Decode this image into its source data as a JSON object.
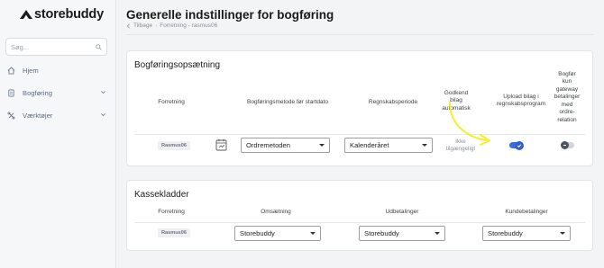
{
  "app": {
    "logo_text": "storebuddy"
  },
  "sidebar": {
    "search_placeholder": "Søg...",
    "items": [
      {
        "label": "Hjem",
        "icon": "home-icon"
      },
      {
        "label": "Bogføring",
        "icon": "document-icon"
      },
      {
        "label": "Værktøjer",
        "icon": "tools-icon"
      }
    ]
  },
  "header": {
    "title": "Generelle indstillinger for bogføring",
    "breadcrumb": {
      "back": "Tilbage",
      "current": "Forretning - rasmus06"
    }
  },
  "accounting_setup": {
    "title": "Bogføringsopsætning",
    "columns": {
      "store": "Forretning",
      "method": "Bogføringsmetode før startdato",
      "period": "Regnskabsperiode",
      "approve": [
        "Godkend",
        "bilag",
        "automatisk"
      ],
      "upload": [
        "Upload bilag i",
        "regnskabsprogram"
      ],
      "gateway": [
        "Bogfør",
        "kun",
        "gateway",
        "betalinger",
        "med",
        "ordre-",
        "relation"
      ]
    },
    "row": {
      "store": "Rasmus06",
      "method": "Ordremetoden",
      "period": "Kalenderåret",
      "approve": [
        "Ikke",
        "tilgængeligt"
      ],
      "upload_enabled": true,
      "gateway_enabled": false
    }
  },
  "cash_ledgers": {
    "title": "Kassekladder",
    "columns": {
      "store": "Forretning",
      "revenue": "Omsætning",
      "payouts": "Udbetalinger",
      "customer_payments": "Kundebetalinger"
    },
    "row": {
      "store": "Rasmus06",
      "revenue": "Storebuddy",
      "payouts": "Storebuddy",
      "customer_payments": "Storebuddy"
    }
  },
  "colors": {
    "accent": "#3b6fe0",
    "annotation": "#f5ef2a"
  }
}
